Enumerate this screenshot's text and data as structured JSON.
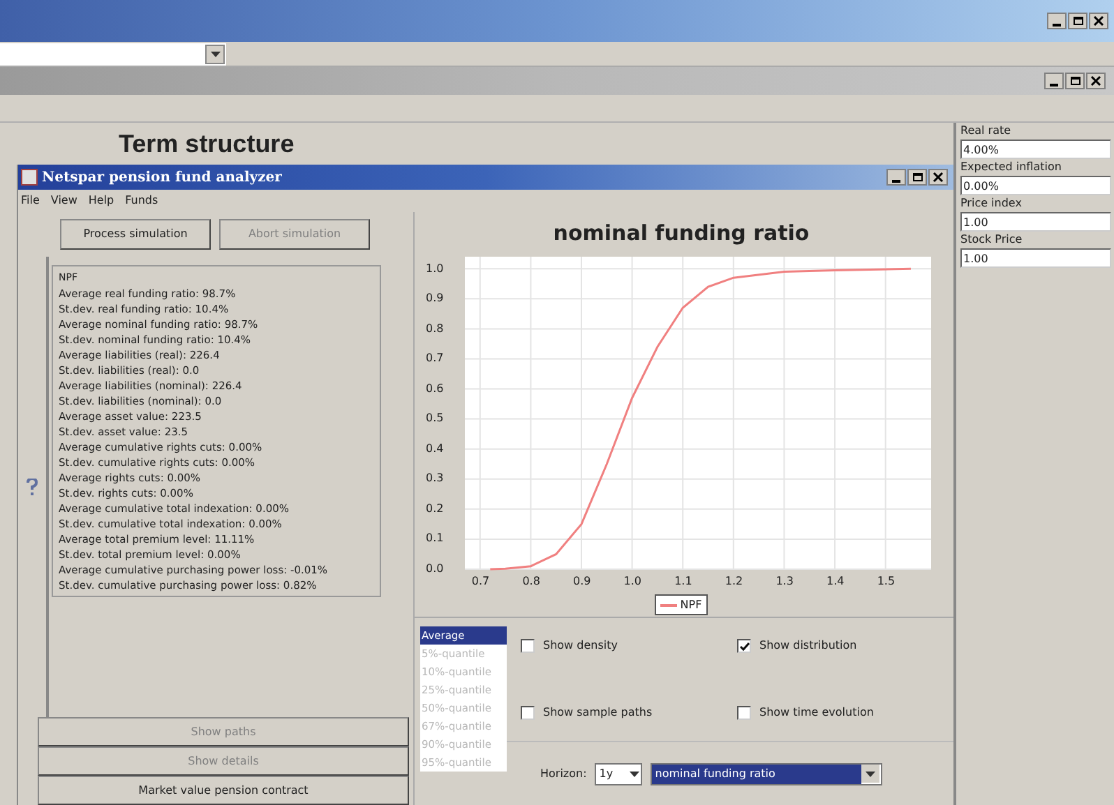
{
  "desk_title": "Term structure",
  "side_fields": [
    {
      "label": "Real rate",
      "value": "4.00%"
    },
    {
      "label": "Expected inflation",
      "value": "0.00%"
    },
    {
      "label": "Price index",
      "value": "1.00"
    },
    {
      "label": "Stock Price",
      "value": "1.00"
    }
  ],
  "app": {
    "title": "Netspar pension fund analyzer",
    "menu": [
      "File",
      "View",
      "Help",
      "Funds"
    ],
    "top_buttons": [
      {
        "label": "Process simulation",
        "disabled": false
      },
      {
        "label": "Abort simulation",
        "disabled": true
      }
    ],
    "stats": {
      "header": "NPF",
      "lines": [
        "Average real funding ratio: 98.7%",
        "St.dev. real funding ratio: 10.4%",
        "Average nominal funding ratio: 98.7%",
        "St.dev. nominal funding ratio: 10.4%",
        "Average liabilities (real): 226.4",
        "St.dev. liabilities (real): 0.0",
        "Average liabilities (nominal): 226.4",
        "St.dev. liabilities (nominal): 0.0",
        "Average asset value: 223.5",
        "St.dev. asset value: 23.5",
        "Average cumulative rights cuts: 0.00%",
        "St.dev. cumulative rights cuts: 0.00%",
        "Average rights cuts: 0.00%",
        "St.dev. rights cuts: 0.00%",
        "Average cumulative total indexation: 0.00%",
        "St.dev. cumulative total indexation: 0.00%",
        "Average total premium level: 11.11%",
        "St.dev. total premium level: 0.00%",
        "Average cumulative purchasing power loss: -0.01%",
        "St.dev. cumulative purchasing power loss: 0.82%"
      ]
    },
    "bottom_buttons": [
      {
        "label": "Show paths",
        "disabled": true
      },
      {
        "label": "Show details",
        "disabled": true
      },
      {
        "label": "Market value pension contract",
        "disabled": false
      }
    ],
    "chart_data": {
      "type": "line",
      "title": "nominal funding ratio",
      "x": [
        0.72,
        0.75,
        0.8,
        0.85,
        0.9,
        0.95,
        1.0,
        1.05,
        1.1,
        1.15,
        1.2,
        1.3,
        1.4,
        1.55
      ],
      "series": [
        {
          "name": "NPF",
          "color": "#f08080",
          "values": [
            0,
            0.002,
            0.01,
            0.05,
            0.15,
            0.35,
            0.57,
            0.74,
            0.87,
            0.94,
            0.97,
            0.99,
            0.995,
            1.0
          ]
        }
      ],
      "xlim": [
        0.67,
        1.59
      ],
      "ylim": [
        0,
        1.04
      ],
      "grid": true,
      "xticks": [
        0.7,
        0.8,
        0.9,
        {
          "value": 1,
          "label": "1.0"
        },
        1.1,
        1.2,
        1.3,
        1.4,
        1.5
      ],
      "yticks": [
        {
          "value": 0,
          "label": "0.0"
        },
        0.1,
        0.2,
        0.3,
        0.4,
        0.5,
        0.6,
        0.7,
        0.8,
        0.9,
        {
          "value": 1,
          "label": "1.0"
        }
      ]
    },
    "quantiles": [
      {
        "label": "Average",
        "selected": true
      },
      {
        "label": "5%-quantile",
        "selected": false
      },
      {
        "label": "10%-quantile",
        "selected": false
      },
      {
        "label": "25%-quantile",
        "selected": false
      },
      {
        "label": "50%-quantile",
        "selected": false
      },
      {
        "label": "67%-quantile",
        "selected": false
      },
      {
        "label": "90%-quantile",
        "selected": false
      },
      {
        "label": "95%-quantile",
        "selected": false
      }
    ],
    "options": [
      {
        "label": "Show density",
        "checked": false
      },
      {
        "label": "Show distribution",
        "checked": true
      },
      {
        "label": "Show sample paths",
        "checked": false
      },
      {
        "label": "Show time evolution",
        "checked": false
      }
    ],
    "horizon": {
      "label": "Horizon:",
      "value": "1y"
    },
    "variable": {
      "value": "nominal funding ratio",
      "highlighted": true
    }
  }
}
